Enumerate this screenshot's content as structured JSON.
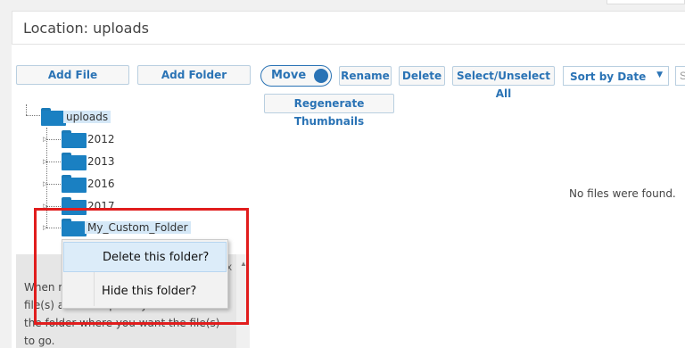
{
  "location": {
    "text": "Location: uploads"
  },
  "toolbar": {
    "add_file": "Add File",
    "add_folder": "Add Folder",
    "move": "Move",
    "rename": "Rename",
    "delete": "Delete",
    "select_unselect_all": "Select/Unselect All",
    "sort": "Sort by Date",
    "sort_caret": "▼",
    "search_stub": "S",
    "regenerate_thumbnails": "Regenerate Thumbnails"
  },
  "tree": {
    "root": "uploads",
    "folders": [
      "2012",
      "2013",
      "2016",
      "2017",
      "My_Custom_Folder"
    ]
  },
  "content": {
    "empty_message": "No files were found."
  },
  "context_menu": {
    "items": [
      "Delete this folder?",
      "Hide this folder?"
    ]
  },
  "help": {
    "text": "When moving files, first select the file(s) and then place your cursor on the folder where you want the file(s) to go.",
    "close": "x"
  },
  "colors": {
    "accent": "#2a73b5",
    "folder": "#1a80c2",
    "highlight": "#e11d1d"
  }
}
